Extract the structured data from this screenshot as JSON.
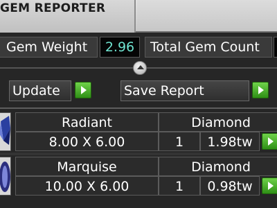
{
  "window": {
    "title": "GEM REPORTER"
  },
  "fields": {
    "gem_weight": {
      "label": "Gem Weight",
      "value": "2.96"
    },
    "total_gem_count": {
      "label": "Total Gem Count"
    }
  },
  "actions": {
    "update_label": "Update",
    "save_report_label": "Save Report"
  },
  "gems": [
    {
      "cut": "Radiant",
      "type": "Diamond",
      "size": "8.00 X 6.00",
      "count": "1",
      "weight": "1.98tw"
    },
    {
      "cut": "Marquise",
      "type": "Diamond",
      "size": "10.00 X 6.00",
      "count": "1",
      "weight": "0.98tw"
    }
  ],
  "colors": {
    "accent_value": "#6fe3d0",
    "go_button": "#4cae2a",
    "panel_bg": "#262626"
  }
}
